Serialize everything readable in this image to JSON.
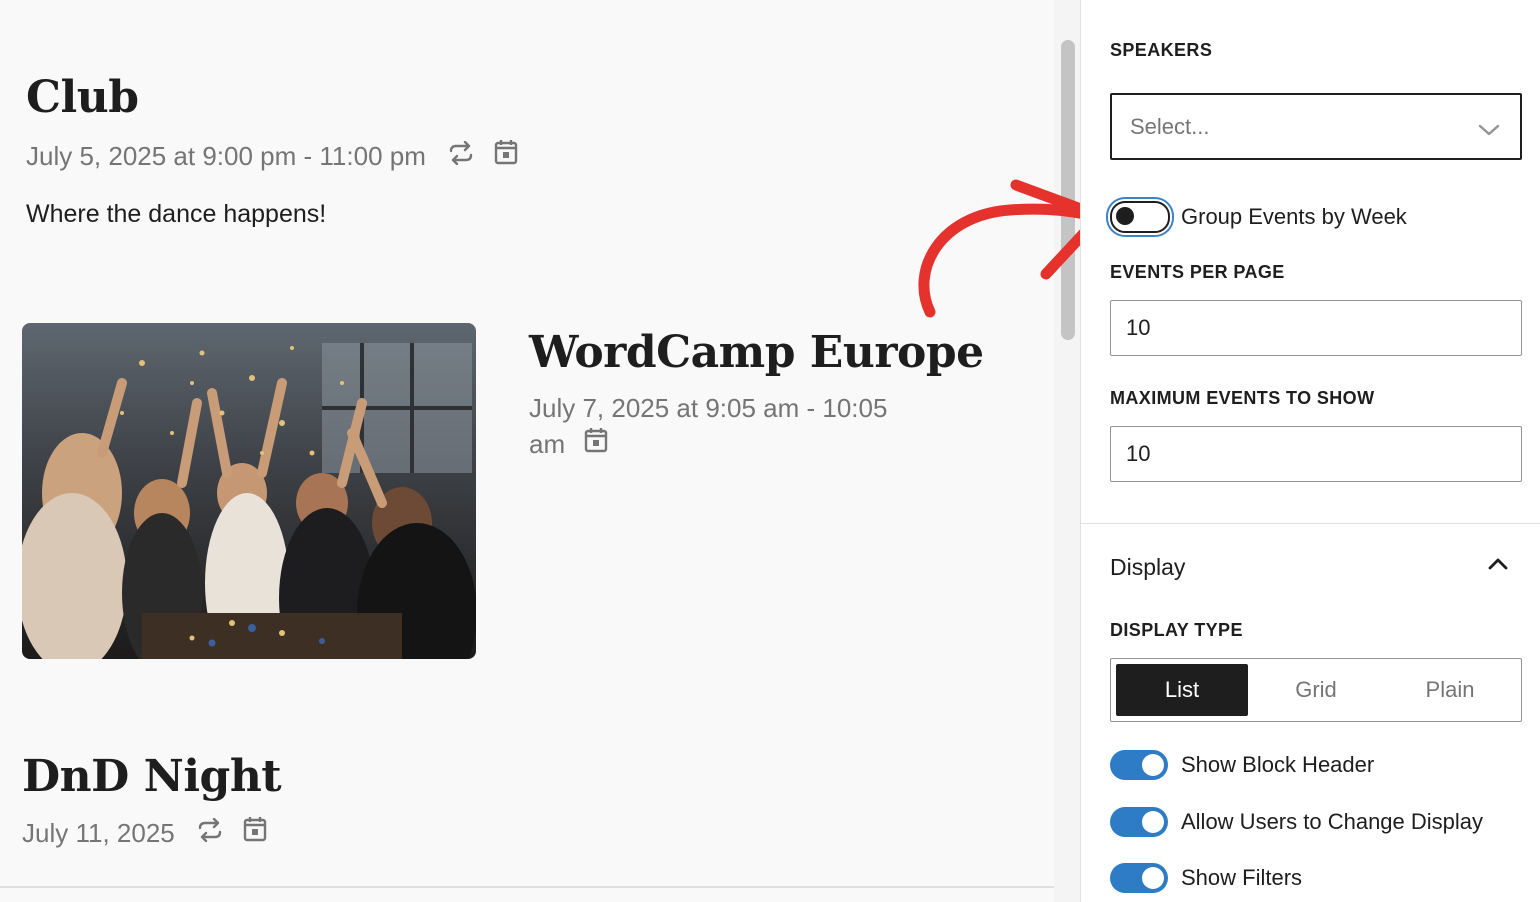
{
  "events": [
    {
      "title": "Club",
      "date": "July 5, 2025 at 9:00 pm - 11:00 pm",
      "description": "Where the dance happens!",
      "recurring": true
    },
    {
      "title": "WordCamp Europe",
      "date_line1": "July 7, 2025 at 9:05 am - 10:05",
      "date_line2": "am",
      "recurring": false
    },
    {
      "title": "DnD Night",
      "date": "July 11, 2025",
      "recurring": true
    }
  ],
  "panel": {
    "speakers_label": "SPEAKERS",
    "speakers_placeholder": "Select...",
    "group_events_label": "Group Events by Week",
    "group_events_on": false,
    "events_per_page_label": "EVENTS PER PAGE",
    "events_per_page_value": "10",
    "max_events_label": "MAXIMUM EVENTS TO SHOW",
    "max_events_value": "10",
    "display_heading": "Display",
    "display_type_label": "DISPLAY TYPE",
    "display_types": [
      "List",
      "Grid",
      "Plain"
    ],
    "display_type_selected": "List",
    "toggles": [
      {
        "label": "Show Block Header",
        "on": true
      },
      {
        "label": "Allow Users to Change Display",
        "on": true
      },
      {
        "label": "Show Filters",
        "on": true
      }
    ]
  },
  "colors": {
    "accent": "#2f7cc6",
    "annotation_arrow": "#e5322d",
    "text": "#1e1e1e",
    "muted": "#757575"
  },
  "icons": [
    "recurring-icon",
    "calendar-icon",
    "chevron-down-icon",
    "chevron-up-icon",
    "annotation-arrow-icon"
  ]
}
